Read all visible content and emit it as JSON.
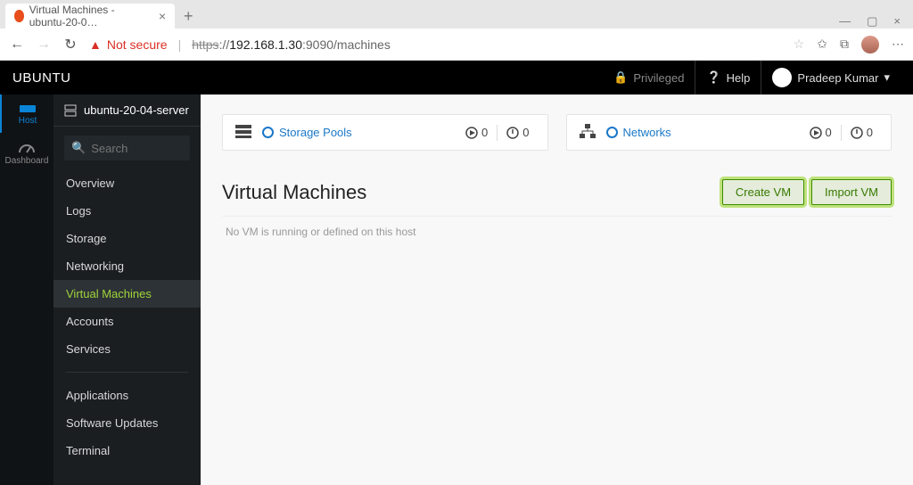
{
  "browser": {
    "tab_title": "Virtual Machines - ubuntu-20-0…",
    "security_label": "Not secure",
    "url_struck": "https",
    "url_mid": "://",
    "url_host": "192.168.1.30",
    "url_port_path": ":9090/machines"
  },
  "header": {
    "brand": "UBUNTU",
    "privileged": "Privileged",
    "help": "Help",
    "user": "Pradeep Kumar"
  },
  "rail": {
    "host": "Host",
    "dashboard": "Dashboard"
  },
  "sidebar": {
    "server": "ubuntu-20-04-server",
    "search_placeholder": "Search",
    "items": [
      "Overview",
      "Logs",
      "Storage",
      "Networking",
      "Virtual Machines",
      "Accounts",
      "Services"
    ],
    "items2": [
      "Applications",
      "Software Updates",
      "Terminal"
    ],
    "active_index": 4
  },
  "cards": {
    "storage_pools": {
      "label": "Storage Pools",
      "running": "0",
      "stopped": "0"
    },
    "networks": {
      "label": "Networks",
      "running": "0",
      "stopped": "0"
    }
  },
  "vm": {
    "title": "Virtual Machines",
    "create": "Create VM",
    "import": "Import VM",
    "empty": "No VM is running or defined on this host"
  }
}
